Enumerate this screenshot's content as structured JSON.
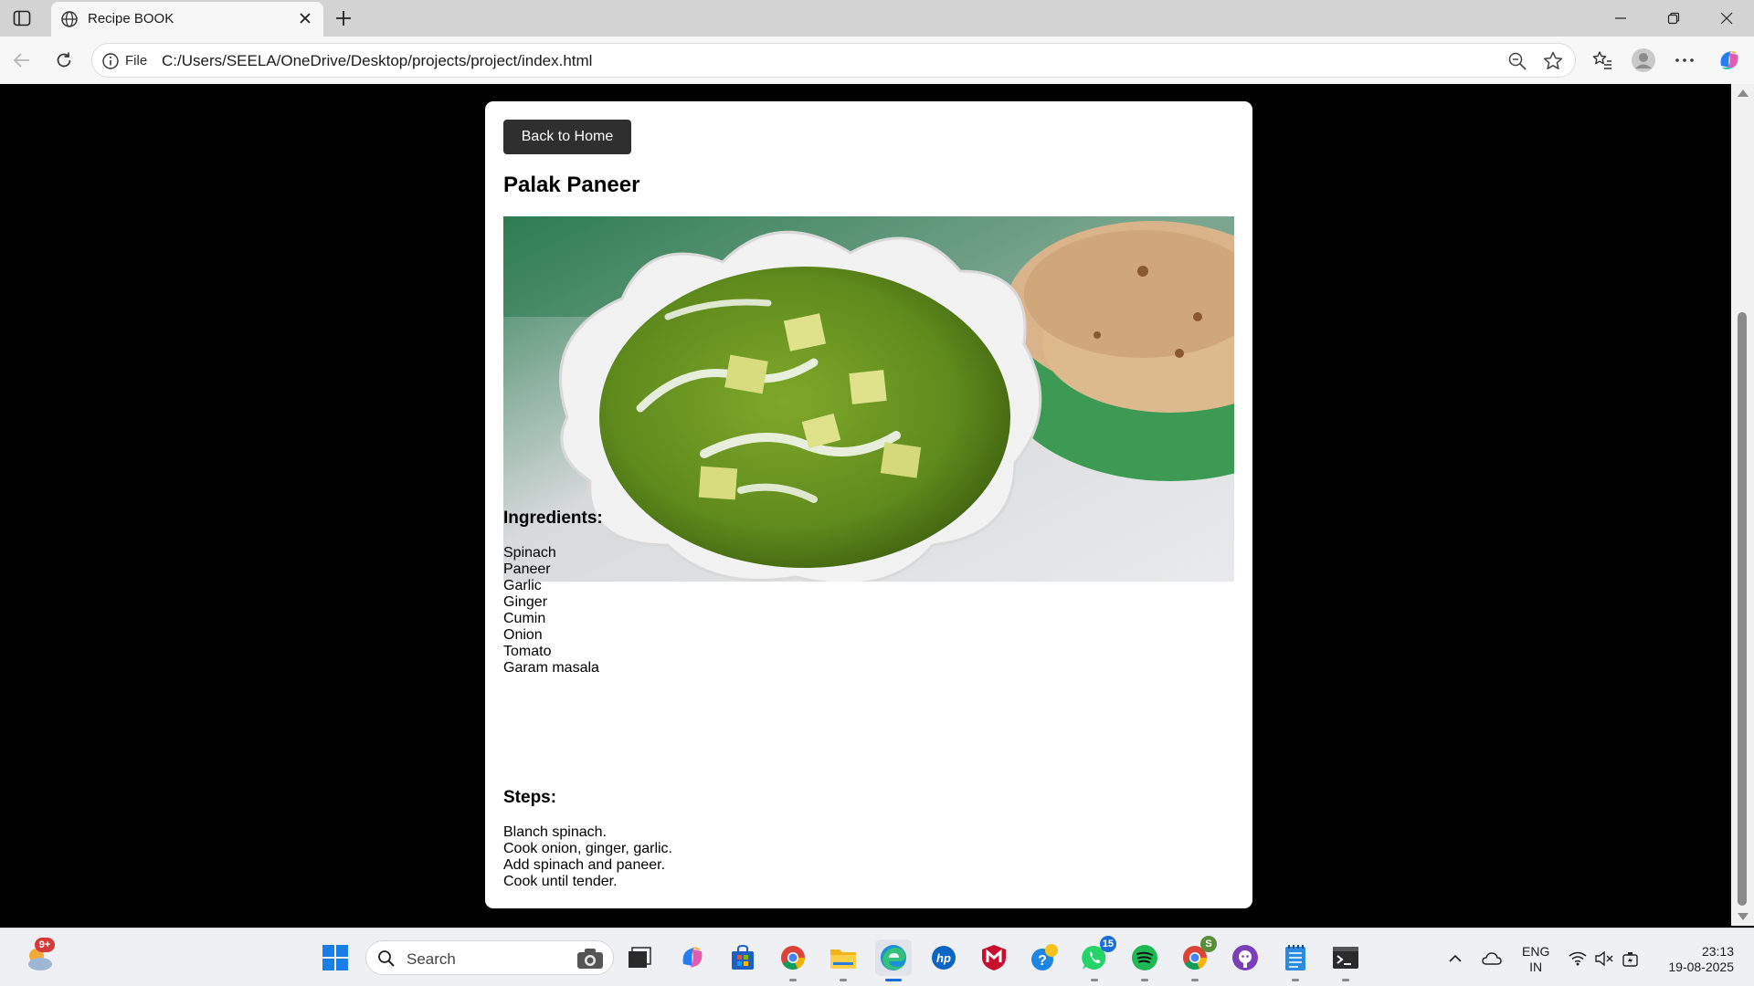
{
  "browser": {
    "tab_title": "Recipe BOOK",
    "address_label": "File",
    "address_url": "C:/Users/SEELA/OneDrive/Desktop/projects/project/index.html"
  },
  "page": {
    "back_button": "Back to Home",
    "recipe_title": "Palak Paneer",
    "image_alt": "Palak Paneer",
    "ingredients_heading": "Ingredients:",
    "ingredients": [
      "Spinach",
      "Paneer",
      "Garlic",
      "Ginger",
      "Cumin",
      "Onion",
      "Tomato",
      "Garam masala"
    ],
    "steps_heading": "Steps:",
    "steps": [
      "Blanch spinach.",
      "Cook onion, ginger, garlic.",
      "Add spinach and paneer.",
      "Cook until tender."
    ]
  },
  "taskbar": {
    "weather_badge": "9+",
    "search_placeholder": "Search",
    "whatsapp_badge": "15",
    "chrome_profile_badge": "S",
    "language_line1": "ENG",
    "language_line2": "IN",
    "time": "23:13",
    "date": "19-08-2025"
  },
  "icons": {
    "tab_favicon": "globe-icon",
    "info": "info-icon",
    "zoom": "zoom-out-icon",
    "favorite": "star-icon",
    "favorites_bar": "favorites-list-icon",
    "profile": "profile-avatar-icon",
    "menu": "more-dots-icon",
    "copilot": "copilot-icon"
  },
  "colors": {
    "page_background": "#000000",
    "card_background": "#ffffff",
    "button_background": "#2f2f2f",
    "edge_accent": "#1a6ed8"
  }
}
